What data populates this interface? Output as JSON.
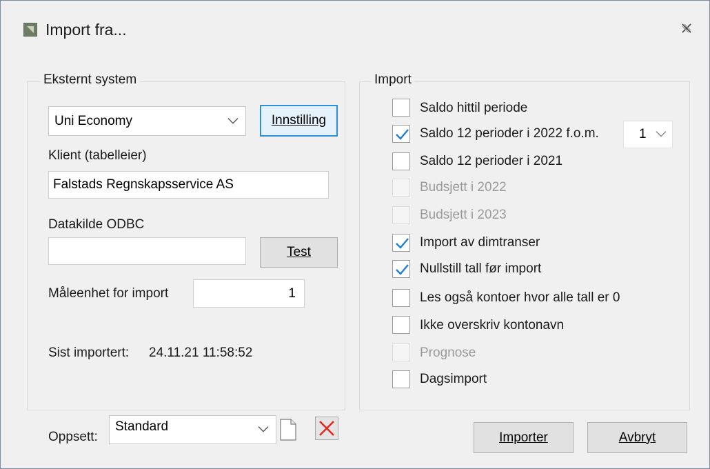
{
  "window": {
    "title": "Import fra..."
  },
  "external": {
    "legend": "Eksternt system",
    "system_value": "Uni Economy",
    "settings_button": "Innstilling",
    "client_label": "Klient (tabelleier)",
    "client_value": "Falstads Regnskapsservice AS",
    "odbc_label": "Datakilde ODBC",
    "odbc_value": "",
    "test_button": "Test",
    "unit_label": "Måleenhet for import",
    "unit_value": "1",
    "last_imported_label": "Sist importert:",
    "last_imported_value": "24.11.21 11:58:52"
  },
  "import": {
    "legend": "Import",
    "options": [
      {
        "label": "Saldo hittil periode",
        "checked": false,
        "disabled": false
      },
      {
        "label": "Saldo 12 perioder i 2022 f.o.m.",
        "checked": true,
        "disabled": false
      },
      {
        "label": "Saldo 12 perioder i 2021",
        "checked": false,
        "disabled": false
      },
      {
        "label": "Budsjett i 2022",
        "checked": false,
        "disabled": true
      },
      {
        "label": "Budsjett i 2023",
        "checked": false,
        "disabled": true
      },
      {
        "label": "Import av dimtranser",
        "checked": true,
        "disabled": false
      },
      {
        "label": "Nullstill tall før import",
        "checked": true,
        "disabled": false
      },
      {
        "label": "Les også kontoer hvor alle tall er 0",
        "checked": false,
        "disabled": false
      },
      {
        "label": "Ikke overskriv kontonavn",
        "checked": false,
        "disabled": false
      },
      {
        "label": "Prognose",
        "checked": false,
        "disabled": true
      },
      {
        "label": "Dagsimport",
        "checked": false,
        "disabled": false
      }
    ],
    "period_value": "1"
  },
  "setup": {
    "label": "Oppsett:",
    "value": "Standard"
  },
  "buttons": {
    "import": "Importer",
    "cancel": "Avbryt"
  },
  "colors": {
    "check": "#1c7fd6",
    "delete": "#e0281f",
    "default_border": "#2b8fdc"
  }
}
